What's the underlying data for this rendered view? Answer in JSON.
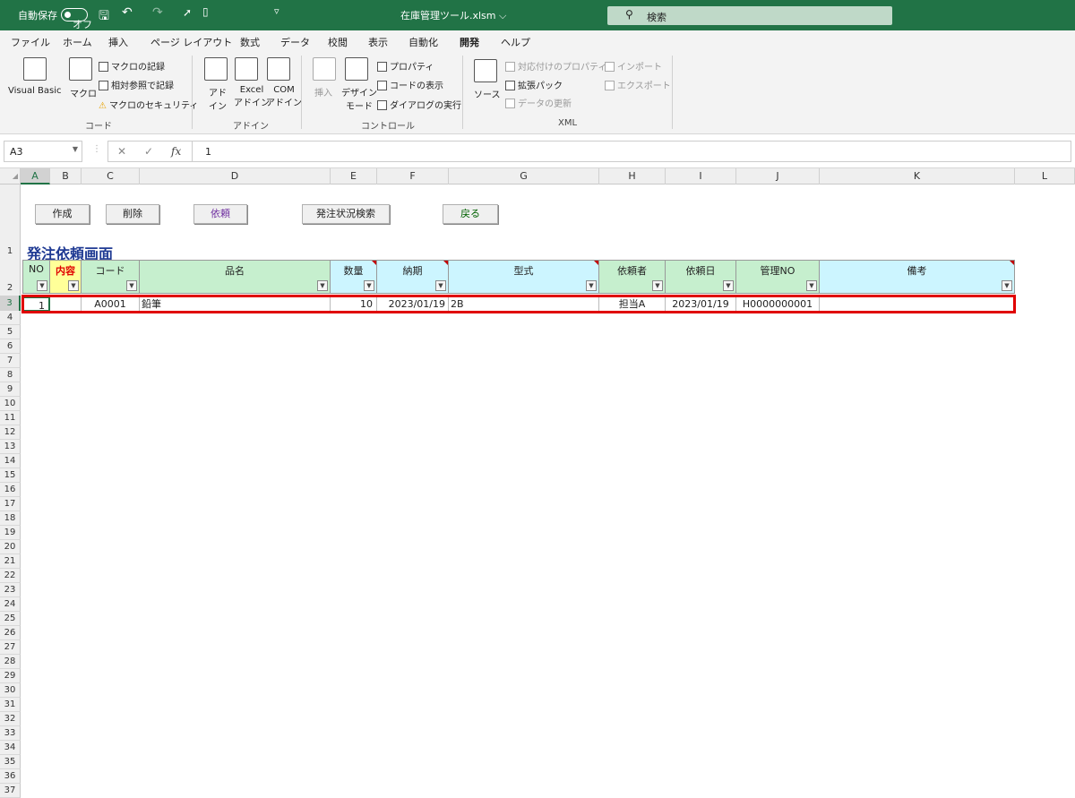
{
  "titlebar": {
    "autosave": "自動保存",
    "autosave_state": "オフ",
    "filename": "在庫管理ツール.xlsm",
    "search": "検索"
  },
  "tabs": [
    "ファイル",
    "ホーム",
    "挿入",
    "ページ レイアウト",
    "数式",
    "データ",
    "校閲",
    "表示",
    "自動化",
    "開発",
    "ヘルプ"
  ],
  "active_tab": "開発",
  "ribbon": {
    "code": {
      "visual_basic": "Visual Basic",
      "macro": "マクロ",
      "record": "マクロの記録",
      "relative": "相対参照で記録",
      "security": "マクロのセキュリティ",
      "label": "コード"
    },
    "addins": {
      "addin1": "アド",
      "addin2": "イン",
      "excel1": "Excel",
      "excel2": "アドイン",
      "com1": "COM",
      "com2": "アドイン",
      "label": "アドイン"
    },
    "controls": {
      "insert": "挿入",
      "design1": "デザイン",
      "design2": "モード",
      "properties": "プロパティ",
      "view_code": "コードの表示",
      "run_dialog": "ダイアログの実行",
      "label": "コントロール"
    },
    "xml": {
      "source": "ソース",
      "map_props": "対応付けのプロパティ",
      "expansion": "拡張パック",
      "refresh": "データの更新",
      "import": "インポート",
      "export": "エクスポート",
      "label": "XML"
    }
  },
  "formula_bar": {
    "name_box": "A3",
    "value": "1"
  },
  "columns": [
    "A",
    "B",
    "C",
    "D",
    "E",
    "F",
    "G",
    "H",
    "I",
    "J",
    "K",
    "L"
  ],
  "rows": [
    "1",
    "2",
    "3",
    "4",
    "5",
    "6",
    "7",
    "8",
    "9",
    "10",
    "11",
    "12",
    "13",
    "14",
    "15",
    "16",
    "17",
    "18",
    "19",
    "20",
    "21",
    "22",
    "23",
    "24",
    "25",
    "26",
    "27",
    "28",
    "29",
    "30",
    "31",
    "32",
    "33",
    "34",
    "35",
    "36",
    "37"
  ],
  "buttons": {
    "create": "作成",
    "delete": "削除",
    "request": "依頼",
    "search_status": "発注状況検索",
    "back": "戻る"
  },
  "sheet_title": "発注依頼画面",
  "table": {
    "headers": [
      "NO",
      "内容",
      "コード",
      "品名",
      "数量",
      "納期",
      "型式",
      "依頼者",
      "依頼日",
      "管理NO",
      "備考"
    ],
    "row": [
      "1",
      "",
      "A0001",
      "鉛筆",
      "10",
      "2023/01/19",
      "2B",
      "担当A",
      "2023/01/19",
      "H0000000001",
      ""
    ]
  },
  "colors": {
    "excel_green": "#217346",
    "highlight_red": "#e00000",
    "header_green": "#c6efce",
    "header_cyan": "#ccf5ff",
    "header_yellow": "#ffff99"
  }
}
